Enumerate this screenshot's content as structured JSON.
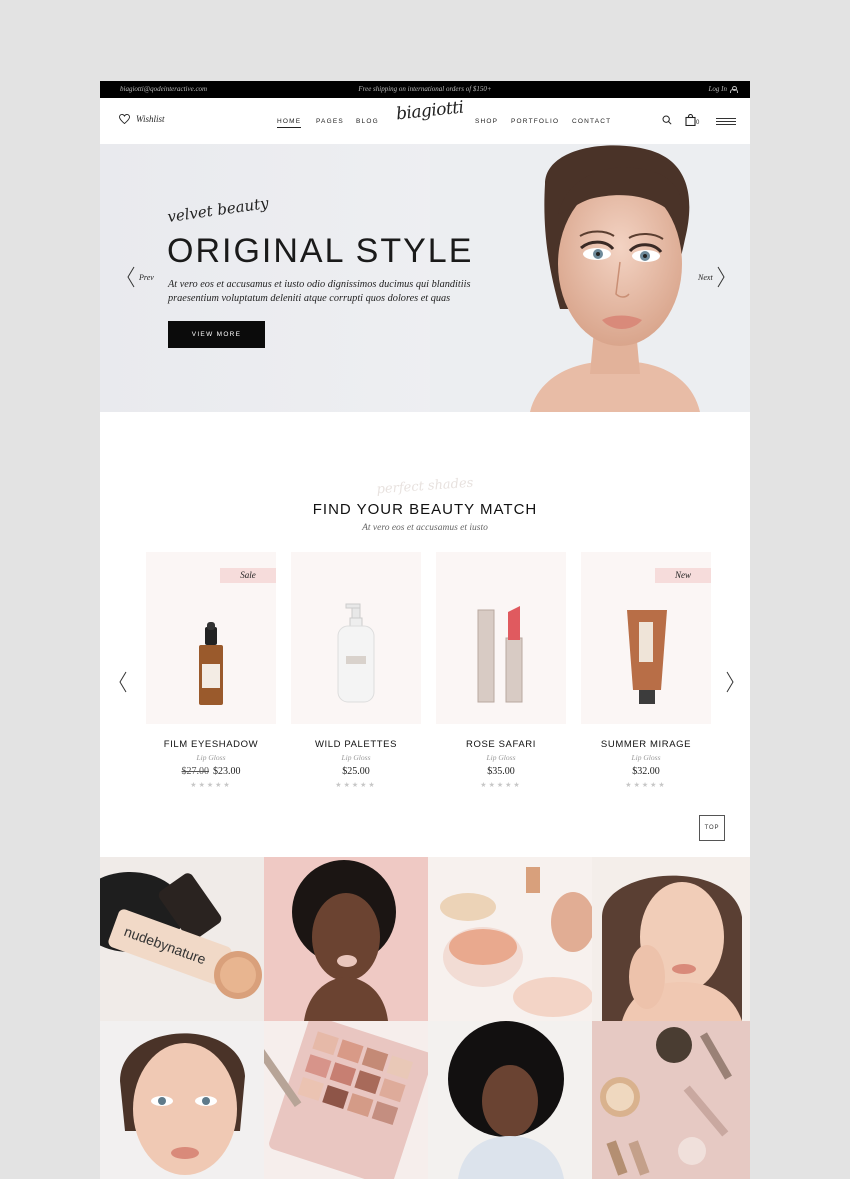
{
  "topbar": {
    "email": "biagiotti@qodeinteractive.com",
    "shipping": "Free shipping on international orders of $150+",
    "login": "Log In"
  },
  "header": {
    "wishlist": "Wishlist",
    "logo": "biagiotti",
    "nav": [
      "HOME",
      "PAGES",
      "BLOG",
      "SHOP",
      "PORTFOLIO",
      "CONTACT"
    ],
    "cart_count": "0"
  },
  "hero": {
    "script": "velvet beauty",
    "title": "ORIGINAL STYLE",
    "text": "At vero eos et accusamus et iusto odio dignissimos ducimus qui blanditiis praesentium voluptatum deleniti atque corrupti quos dolores et quas",
    "button": "VIEW MORE",
    "prev": "Prev",
    "next": "Next"
  },
  "section": {
    "script": "perfect shades",
    "title": "FIND YOUR BEAUTY MATCH",
    "subtitle": "At vero eos et accusamus et iusto"
  },
  "products": [
    {
      "name": "FILM EYESHADOW",
      "category": "Lip Gloss",
      "old_price": "$27.00",
      "price": "$23.00",
      "badge": "Sale",
      "stars": "★★★★★"
    },
    {
      "name": "WILD PALETTES",
      "category": "Lip Gloss",
      "old_price": "",
      "price": "$25.00",
      "badge": "",
      "stars": "★★★★★"
    },
    {
      "name": "ROSE SAFARI",
      "category": "Lip Gloss",
      "old_price": "",
      "price": "$35.00",
      "badge": "",
      "stars": "★★★★★"
    },
    {
      "name": "SUMMER MIRAGE",
      "category": "Lip Gloss",
      "old_price": "",
      "price": "$32.00",
      "badge": "New",
      "stars": "★★★★★"
    }
  ],
  "top_button": "TOP",
  "gallery": {
    "brand_text": "nudebynature"
  },
  "colors": {
    "accent_pink": "#f6dcdb",
    "card_bg": "#fbf6f5",
    "dark": "#0b0b0b"
  }
}
